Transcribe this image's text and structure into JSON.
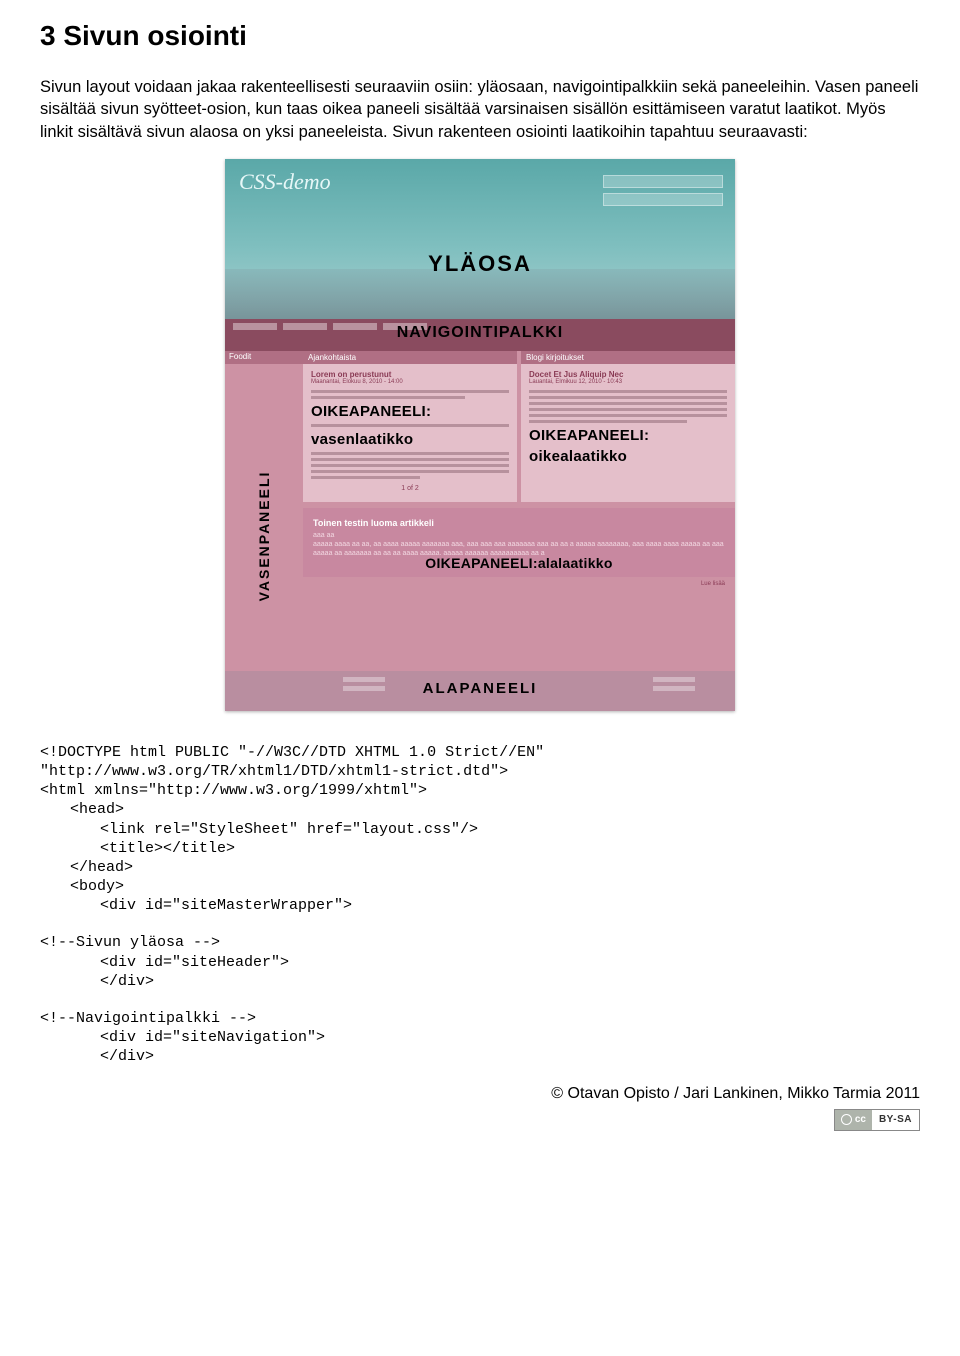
{
  "heading": "3 Sivun osiointi",
  "para1": "Sivun layout voidaan jakaa rakenteellisesti seuraaviin osiin: yläosaan, navigointipalkkiin sekä paneeleihin. Vasen paneeli sisältää sivun syötteet-osion, kun taas oikea paneeli sisältää varsinaisen sisällön esittämiseen varatut laatikot. Myös linkit sisältävä sivun alaosa on yksi paneeleista. Sivun rakenteen osiointi laatikoihin tapahtuu seuraavasti:",
  "screenshot": {
    "header_script": "CSS-demo",
    "ylaosa": "YLÄOSA",
    "nav": "NAVIGOINTIPALKKI",
    "left_header": "Foodit",
    "vasen": "VASENPANEELI",
    "card_left": {
      "header": "Ajankohtaista",
      "title": "Lorem on perustunut",
      "sub": "Maanantai, Elokuu 8, 2010 - 14:00",
      "overlay1": "OIKEAPANEELI:",
      "overlay2": "vasenlaatikko",
      "page": "1 of 2"
    },
    "card_right": {
      "header": "Blogi kirjoitukset",
      "title": "Docet Et Jus Aliquip Nec",
      "sub": "Lauantai, Elmikuu 12, 2010 - 10:43",
      "overlay1": "OIKEAPANEELI:",
      "overlay2": "oikealaatikko"
    },
    "bottom_box": {
      "title": "Toinen testin luoma artikkeli",
      "overlay": "OIKEAPANEELI:alalaatikko",
      "readmore": "Lue lisää"
    },
    "footer": "ALAPANEELI"
  },
  "code": {
    "l1": "<!DOCTYPE html PUBLIC \"-//W3C//DTD XHTML 1.0 Strict//EN\"",
    "l2": "\"http://www.w3.org/TR/xhtml1/DTD/xhtml1-strict.dtd\">",
    "l3": "<html xmlns=\"http://www.w3.org/1999/xhtml\">",
    "l4": "<head>",
    "l5": "<link rel=\"StyleSheet\" href=\"layout.css\"/>",
    "l6": "<title></title>",
    "l7": "</head>",
    "l8": "<body>",
    "l9": "<div id=\"siteMasterWrapper\">",
    "c1": "<!--Sivun yläosa -->",
    "l10": "<div id=\"siteHeader\">",
    "l11": "</div>",
    "c2": "<!--Navigointipalkki -->",
    "l12": "<div id=\"siteNavigation\">",
    "l13": "</div>"
  },
  "footer_credit": "© Otavan Opisto / Jari Lankinen, Mikko Tarmia 2011",
  "cc": {
    "left": "cc",
    "right": "BY-SA"
  }
}
